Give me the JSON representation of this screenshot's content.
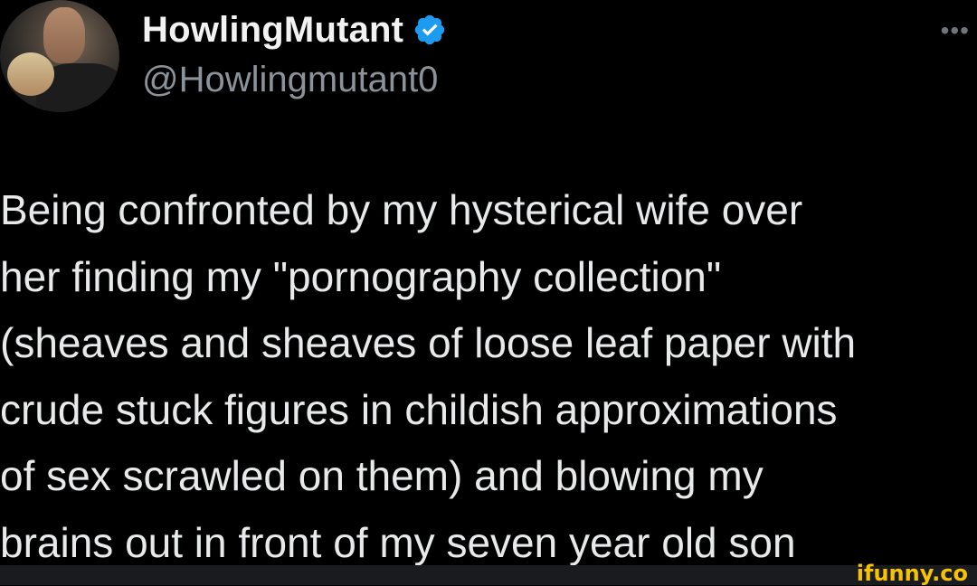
{
  "tweet": {
    "author": {
      "display_name": "HowlingMutant",
      "handle": "@Howlingmutant0",
      "verified": true,
      "avatar_icon": "profile-photo"
    },
    "more_menu_glyph": "•••",
    "text_lines": [
      "Being confronted by my hysterical wife over",
      "her finding my \"pornography collection\"",
      "(sheaves and sheaves of loose leaf paper with",
      "crude stuck figures in childish approximations",
      "of sex scrawled on them) and blowing my",
      "brains out in front of my seven year old son"
    ]
  },
  "watermark": {
    "text": "ifunny.co",
    "color": "#f7c200"
  },
  "colors": {
    "background": "#000000",
    "text": "#e7e9ea",
    "handle": "#8b9299",
    "verified": "#1d9bf0"
  }
}
